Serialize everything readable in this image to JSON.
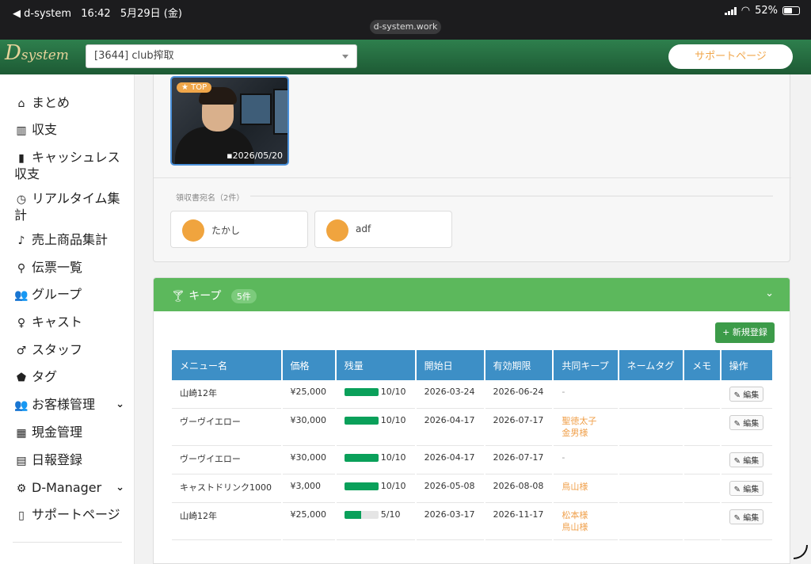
{
  "status": {
    "back_app": "◀ d-system",
    "time": "16:42",
    "date": "5月29日 (金)",
    "battery": "52%",
    "url": "d-system.work"
  },
  "header": {
    "logo_initial": "D",
    "logo_rest": "system",
    "store_select": "[3644] club搾取",
    "support_button": "サポートページ"
  },
  "sidebar": {
    "items": [
      {
        "label": "まとめ",
        "icon": "home-icon",
        "glyph": "⌂"
      },
      {
        "label": "収支",
        "icon": "bar-chart-icon",
        "glyph": "▥"
      },
      {
        "label": "キャッシュレス収支",
        "icon": "building-icon",
        "glyph": "▮"
      },
      {
        "label": "リアルタイム集計",
        "icon": "clock-icon",
        "glyph": "◷"
      },
      {
        "label": "売上商品集計",
        "icon": "guitar-icon",
        "glyph": "♪"
      },
      {
        "label": "伝票一覧",
        "icon": "search-icon",
        "glyph": "⚲"
      },
      {
        "label": "グループ",
        "icon": "users-icon",
        "glyph": "👥"
      },
      {
        "label": "キャスト",
        "icon": "female-icon",
        "glyph": "♀"
      },
      {
        "label": "スタッフ",
        "icon": "male-icon",
        "glyph": "♂"
      },
      {
        "label": "タグ",
        "icon": "tags-icon",
        "glyph": "⬟"
      },
      {
        "label": "お客様管理",
        "icon": "users-icon",
        "glyph": "👥"
      },
      {
        "label": "現金管理",
        "icon": "calculator-icon",
        "glyph": "▦"
      },
      {
        "label": "日報登録",
        "icon": "calendar-icon",
        "glyph": "▤"
      },
      {
        "label": "D-Manager",
        "icon": "gear-icon",
        "glyph": "⚙"
      },
      {
        "label": "サポートページ",
        "icon": "file-icon",
        "glyph": "▯"
      }
    ]
  },
  "profile": {
    "top_badge": "★ TOP",
    "photo_date": "▪2026/05/20"
  },
  "receipt": {
    "label": "領収書宛名（2件）",
    "names": [
      "たかし",
      "adf"
    ]
  },
  "keep": {
    "title": "キープ",
    "count": "5件",
    "new_button": "+ 新規登録",
    "columns": [
      "メニュー名",
      "価格",
      "残量",
      "開始日",
      "有効期限",
      "共同キープ",
      "ネームタグ",
      "メモ",
      "操作"
    ],
    "edit_label": "編集",
    "rows": [
      {
        "menu": "山崎12年",
        "price": "¥25,000",
        "remaining": "10/10",
        "ratio": 1.0,
        "start": "2026-03-24",
        "expiry": "2026-06-24",
        "shared": [
          "-"
        ]
      },
      {
        "menu": "ヴーヴイエロー",
        "price": "¥30,000",
        "remaining": "10/10",
        "ratio": 1.0,
        "start": "2026-04-17",
        "expiry": "2026-07-17",
        "shared": [
          "聖徳太子",
          "金男様"
        ]
      },
      {
        "menu": "ヴーヴイエロー",
        "price": "¥30,000",
        "remaining": "10/10",
        "ratio": 1.0,
        "start": "2026-04-17",
        "expiry": "2026-07-17",
        "shared": [
          "-"
        ]
      },
      {
        "menu": "キャストドリンク1000",
        "price": "¥3,000",
        "remaining": "10/10",
        "ratio": 1.0,
        "start": "2026-05-08",
        "expiry": "2026-08-08",
        "shared": [
          "鳥山様"
        ]
      },
      {
        "menu": "山崎12年",
        "price": "¥25,000",
        "remaining": "5/10",
        "ratio": 0.5,
        "start": "2026-03-17",
        "expiry": "2026-11-17",
        "shared": [
          "松本様",
          "鳥山様"
        ]
      }
    ]
  }
}
